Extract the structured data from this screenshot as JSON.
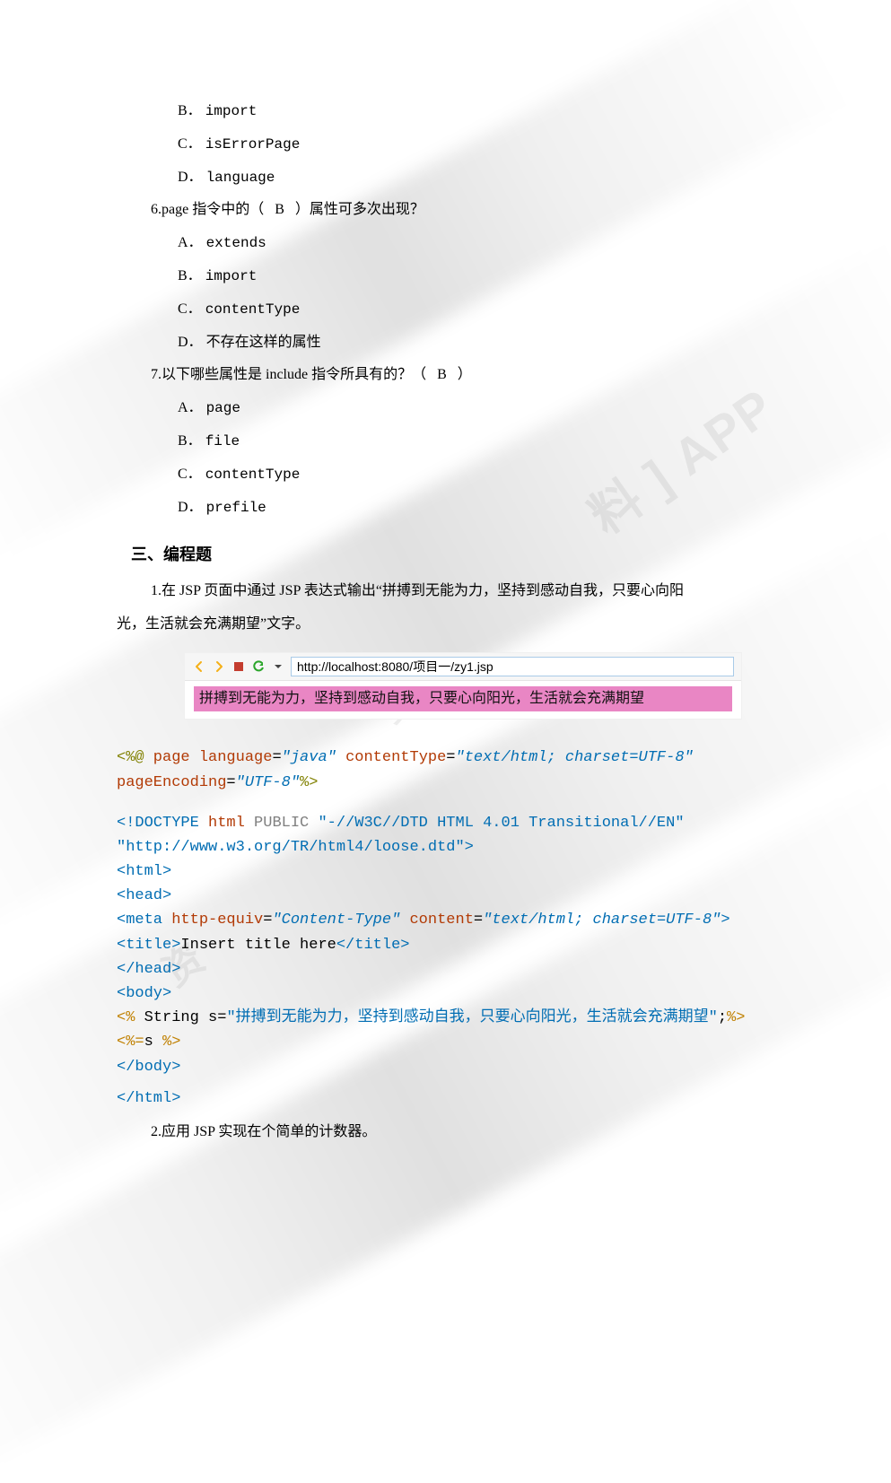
{
  "q_prefix_options": {
    "b": "B．",
    "c": "C．",
    "d": "D．",
    "a": "A．"
  },
  "intro_opts": {
    "b": "import",
    "c": "isErrorPage",
    "d": "language"
  },
  "q6": {
    "text_pre": "6.page 指令中的（",
    "ans": "B",
    "text_post": "）属性可多次出现？",
    "opts": {
      "a": "extends",
      "b": "import",
      "c": "contentType",
      "d": "不存在这样的属性"
    }
  },
  "q7": {
    "text_pre": "7.以下哪些属性是 include 指令所具有的？（",
    "ans": "B",
    "text_post": "）",
    "opts": {
      "a": "page",
      "b": "file",
      "c": "contentType",
      "d": "prefile"
    }
  },
  "section3_title": "三、编程题",
  "prog1": {
    "text_line1": "1.在 JSP 页面中通过 JSP 表达式输出“拼搏到无能为力，坚持到感动自我，只要心向阳",
    "text_line2": "光，生活就会充满期望”文字。"
  },
  "browser": {
    "url": "http://localhost:8080/项目一/zy1.jsp",
    "page_text": "拼搏到无能为力，坚持到感动自我，只要心向阳光，生活就会充满期望"
  },
  "code": {
    "l01a": "<%@",
    "l01b": " page ",
    "l01c": "language",
    "l01d": "=",
    "l01e": "\"java\"",
    "l01f": " contentType",
    "l01g": "=",
    "l01h": "\"text/html; charset=UTF-8\"",
    "l02a": "pageEncoding",
    "l02b": "=",
    "l02c": "\"UTF-8\"",
    "l02d": "%>",
    "l03a": "<!DOCTYPE ",
    "l03b": "html ",
    "l03c": "PUBLIC ",
    "l03d": "\"-//W3C//DTD HTML 4.01 Transitional//EN\"",
    "l04a": "\"http://www.w3.org/TR/html4/loose.dtd\"",
    "l04b": ">",
    "l05": "<html>",
    "l06": "<head>",
    "l07a": "<meta ",
    "l07b": "http-equiv",
    "l07c": "=",
    "l07d": "\"Content-Type\"",
    "l07e": " content",
    "l07f": "=",
    "l07g": "\"text/html; charset=UTF-8\"",
    "l07h": ">",
    "l08a": "<title>",
    "l08b": "Insert title here",
    "l08c": "</title>",
    "l09": "</head>",
    "l10": "<body>",
    "l11a": "<% ",
    "l11b": "String s=",
    "l11c": "\"拼搏到无能为力，坚持到感动自我，只要心向阳光，生活就会充满期望\"",
    "l11d": ";",
    "l11e": "%>",
    "l12a": "<%=",
    "l12b": "s ",
    "l12c": "%>",
    "l13": "</body>",
    "l14": "</html>"
  },
  "prog2": "2.应用 JSP 实现在个简单的计数器。"
}
